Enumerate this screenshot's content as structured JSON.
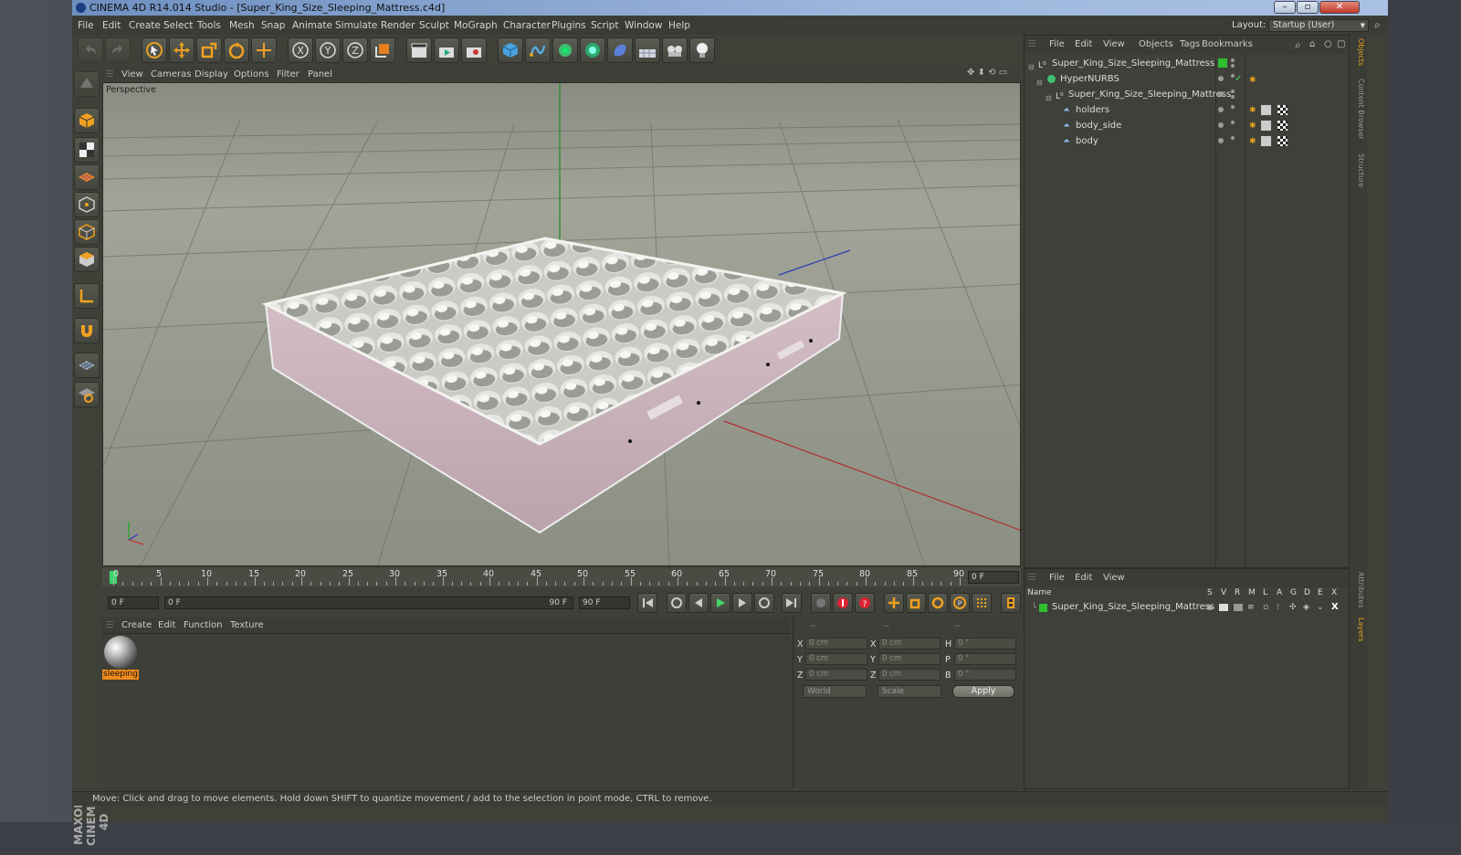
{
  "window": {
    "title": "CINEMA 4D R14.014 Studio - [Super_King_Size_Sleeping_Mattress.c4d]"
  },
  "menu": [
    "File",
    "Edit",
    "Create",
    "Select",
    "Tools",
    "Mesh",
    "Snap",
    "Animate",
    "Simulate",
    "Render",
    "Sculpt",
    "MoGraph",
    "Character",
    "Plugins",
    "Script",
    "Window",
    "Help"
  ],
  "layout": {
    "label": "Layout:",
    "value": "Startup (User)"
  },
  "viewport": {
    "menu": [
      "View",
      "Cameras",
      "Display",
      "Options",
      "Filter",
      "Panel"
    ],
    "label": "Perspective"
  },
  "timeline": {
    "ticks": [
      "0",
      "5",
      "10",
      "15",
      "20",
      "25",
      "30",
      "35",
      "40",
      "45",
      "50",
      "55",
      "60",
      "65",
      "70",
      "75",
      "80",
      "85",
      "90"
    ],
    "current": "0 F"
  },
  "transport": {
    "start": "0 F",
    "range_start": "0 F",
    "range_end": "90 F",
    "end": "90 F"
  },
  "material": {
    "menu": [
      "Create",
      "Edit",
      "Function",
      "Texture"
    ],
    "name": "sleeping"
  },
  "coords": {
    "headers": [
      "--",
      "--",
      "--"
    ],
    "rows": [
      {
        "a": "X",
        "av": "0 cm",
        "b": "X",
        "bv": "0 cm",
        "c": "H",
        "cv": "0 °"
      },
      {
        "a": "Y",
        "av": "0 cm",
        "b": "Y",
        "bv": "0 cm",
        "c": "P",
        "cv": "0 °"
      },
      {
        "a": "Z",
        "av": "0 cm",
        "b": "Z",
        "bv": "0 cm",
        "c": "B",
        "cv": "0 °"
      }
    ],
    "mode": "World",
    "scale": "Scale",
    "apply": "Apply"
  },
  "objects": {
    "menu": [
      "File",
      "Edit",
      "View",
      "Objects",
      "Tags",
      "Bookmarks"
    ],
    "items": [
      {
        "name": "Super_King_Size_Sleeping_Mattress",
        "level": 0
      },
      {
        "name": "HyperNURBS",
        "level": 1
      },
      {
        "name": "Super_King_Size_Sleeping_Mattress",
        "level": 2
      },
      {
        "name": "holders",
        "level": 3
      },
      {
        "name": "body_side",
        "level": 3
      },
      {
        "name": "body",
        "level": 3
      }
    ]
  },
  "layers": {
    "menu": [
      "File",
      "Edit",
      "View"
    ],
    "columns": [
      "Name",
      "S",
      "V",
      "R",
      "M",
      "L",
      "A",
      "G",
      "D",
      "E",
      "X"
    ],
    "row": "Super_King_Size_Sleeping_Mattress",
    "color": "#2fbf2f"
  },
  "sidetabs": [
    "Objects",
    "Content Browser",
    "Structure",
    "Attributes",
    "Layers"
  ],
  "brand": "MAXON CINEMA 4D",
  "status": "Move: Click and drag to move elements. Hold down SHIFT to quantize movement / add to the selection in point mode, CTRL to remove."
}
